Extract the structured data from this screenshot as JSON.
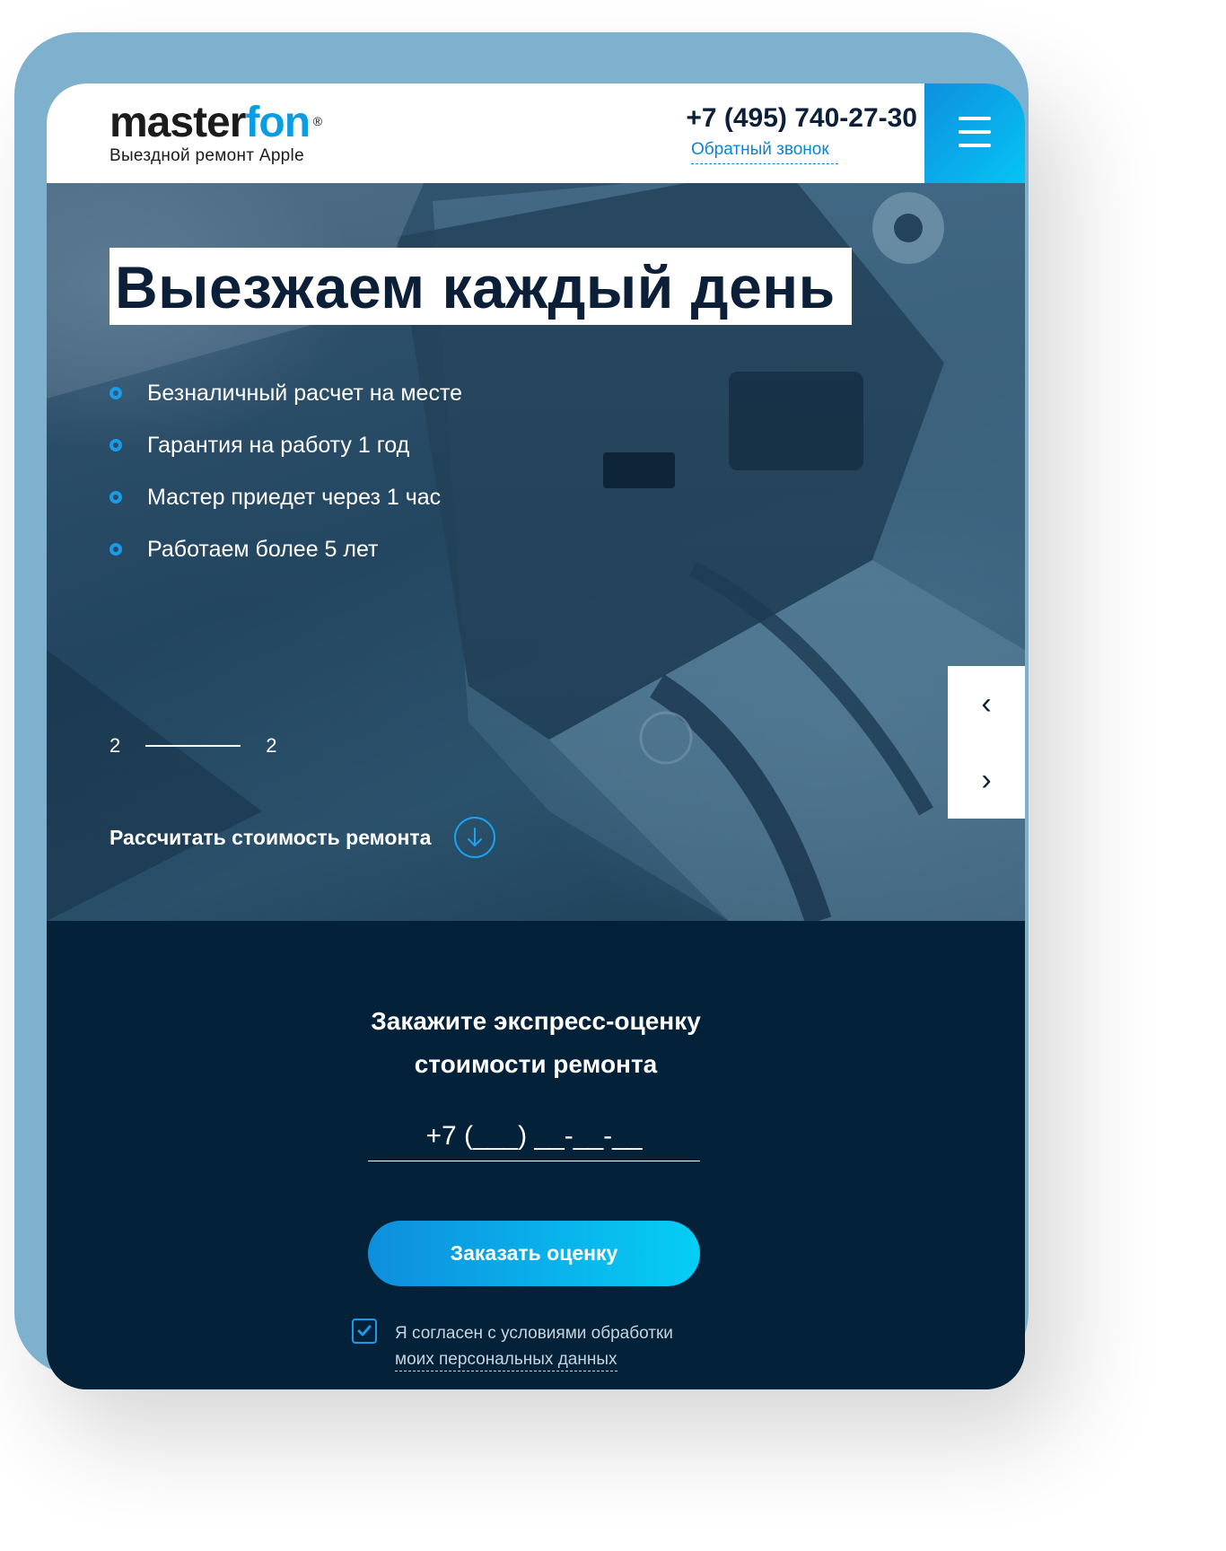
{
  "header": {
    "logo_main": "master",
    "logo_accent": "fon",
    "logo_reg": "®",
    "tagline": "Выездной ремонт Apple",
    "phone": "+7 (495) 740-27-30",
    "callback_label": "Обратный звонок",
    "menu_icon": "hamburger-icon"
  },
  "hero": {
    "title": "Выезжаем каждый день",
    "features": [
      "Безналичный расчет на месте",
      "Гарантия на работу 1 год",
      "Мастер приедет через 1 час",
      "Работаем более 5 лет"
    ],
    "slide_current": "2",
    "slide_total": "2",
    "prev_icon": "‹",
    "next_icon": "›",
    "calc_label": "Рассчитать стоимость ремонта",
    "calc_icon": "arrow-down-circle-icon"
  },
  "form": {
    "title_line1": "Закажите экспресс-оценку",
    "title_line2": "стоимости ремонта",
    "phone_placeholder": "+7 (___) __-__-__",
    "submit_label": "Заказать оценку",
    "consent_line1": "Я согласен с условиями обработки",
    "consent_line2": "моих персональных данных",
    "consent_checked": true
  },
  "colors": {
    "accent": "#0b9de3",
    "dark_navy": "#03223a",
    "frame": "#7eb1cd",
    "gradient_start": "#0e8edd",
    "gradient_end": "#06cef5"
  }
}
